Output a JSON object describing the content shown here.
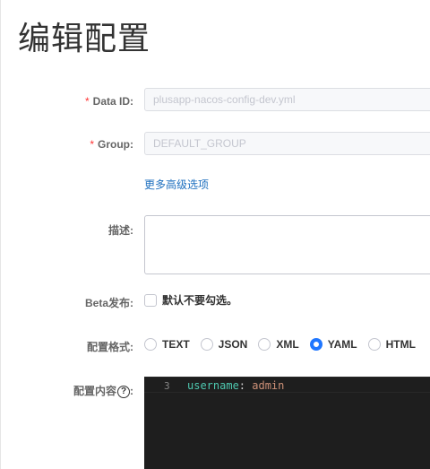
{
  "page": {
    "title": "编辑配置"
  },
  "form": {
    "data_id": {
      "label": "Data ID:",
      "required_mark": "*",
      "value": "plusapp-nacos-config-dev.yml"
    },
    "group": {
      "label": "Group:",
      "required_mark": "*",
      "value": "DEFAULT_GROUP"
    },
    "more_link": "更多高级选项",
    "description": {
      "label": "描述:",
      "value": ""
    },
    "beta": {
      "label": "Beta发布:",
      "checkbox_label": "默认不要勾选。",
      "checked": false
    },
    "format": {
      "label": "配置格式:",
      "options": [
        "TEXT",
        "JSON",
        "XML",
        "YAML",
        "HTML"
      ],
      "selected": "YAML"
    },
    "content": {
      "label": "配置内容",
      "help_glyph": "?",
      "label_colon": ":",
      "line_number": "3",
      "code_key": "username",
      "code_sep": ": ",
      "code_value": "admin"
    }
  },
  "colors": {
    "accent": "#2077ff",
    "link": "#1d6fbf",
    "required": "#ff3333",
    "editor_bg": "#1e1e1e"
  }
}
